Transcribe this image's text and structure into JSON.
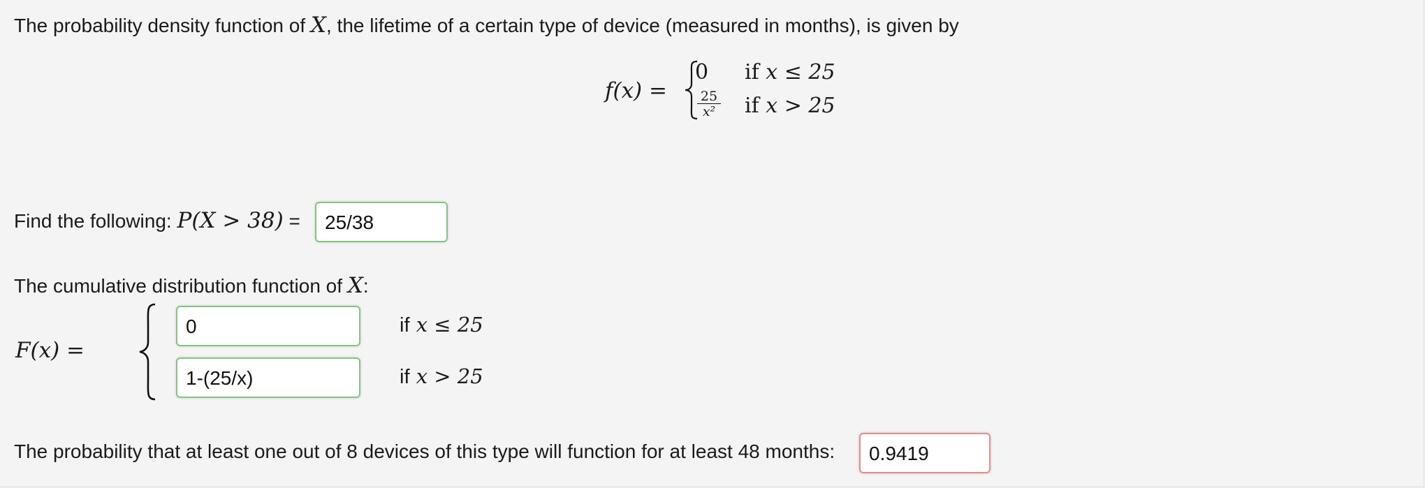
{
  "intro": {
    "before": "The probability density function of",
    "var": "X",
    "after": ", the lifetime of a certain type of device (measured in months), is given by"
  },
  "pdf": {
    "lhs": "f(x) =",
    "case1_value": "0",
    "case1_cond_if": "if",
    "case1_cond": "x ≤ 25",
    "case2_num": "25",
    "case2_den": "x²",
    "case2_cond_if": "if",
    "case2_cond": "x > 25"
  },
  "q1": {
    "prefix": "Find the following:",
    "expr": "P(X > 38)",
    "equals": "=",
    "answer": "25/38"
  },
  "cdf": {
    "heading_before": "The cumulative distribution function of",
    "heading_var": "X",
    "heading_after": ":",
    "lhs": "F(x) =",
    "case1_answer": "0",
    "case1_cond_if": "if",
    "case1_cond": "x ≤ 25",
    "case2_answer": "1-(25/x)",
    "case2_cond_if": "if",
    "case2_cond": "x > 25"
  },
  "q3": {
    "text": "The probability that at least one out of 8 devices of this type will function for at least 48 months:",
    "answer": "0.9419"
  },
  "colors": {
    "background": "#f4f4f4",
    "correct_border": "#86c286",
    "incorrect_border": "#df8f8f"
  }
}
